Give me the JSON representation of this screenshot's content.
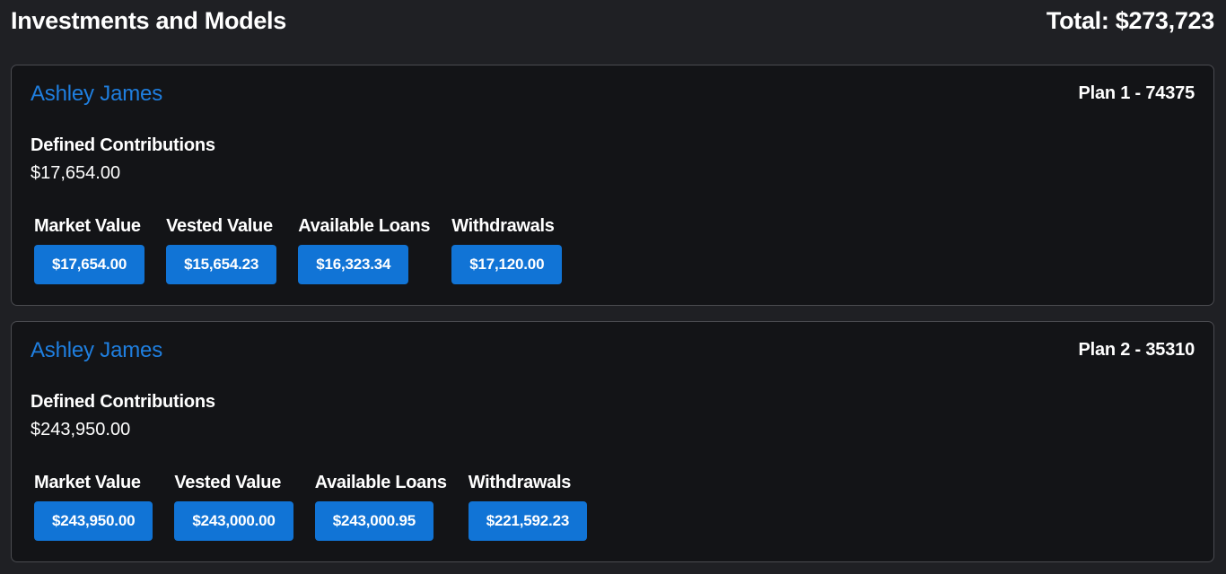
{
  "header": {
    "title": "Investments and Models",
    "total": "Total: $273,723"
  },
  "plans": [
    {
      "holder": "Ashley James",
      "plan": "Plan 1 - 74375",
      "dc_label": "Defined Contributions",
      "dc_value": "$17,654.00",
      "metrics": [
        {
          "label": "Market Value",
          "value": "$17,654.00"
        },
        {
          "label": "Vested Value",
          "value": "$15,654.23"
        },
        {
          "label": "Available Loans",
          "value": "$16,323.34"
        },
        {
          "label": "Withdrawals",
          "value": "$17,120.00"
        }
      ]
    },
    {
      "holder": "Ashley James",
      "plan": "Plan 2 - 35310",
      "dc_label": "Defined Contributions",
      "dc_value": "$243,950.00",
      "metrics": [
        {
          "label": "Market Value",
          "value": "$243,950.00"
        },
        {
          "label": "Vested Value",
          "value": "$243,000.00"
        },
        {
          "label": "Available Loans",
          "value": "$243,000.95"
        },
        {
          "label": "Withdrawals",
          "value": "$221,592.23"
        }
      ]
    }
  ],
  "colors": {
    "accent": "#1f7fe0",
    "button": "#1174d6",
    "background": "#1f2024",
    "card": "#131417"
  }
}
